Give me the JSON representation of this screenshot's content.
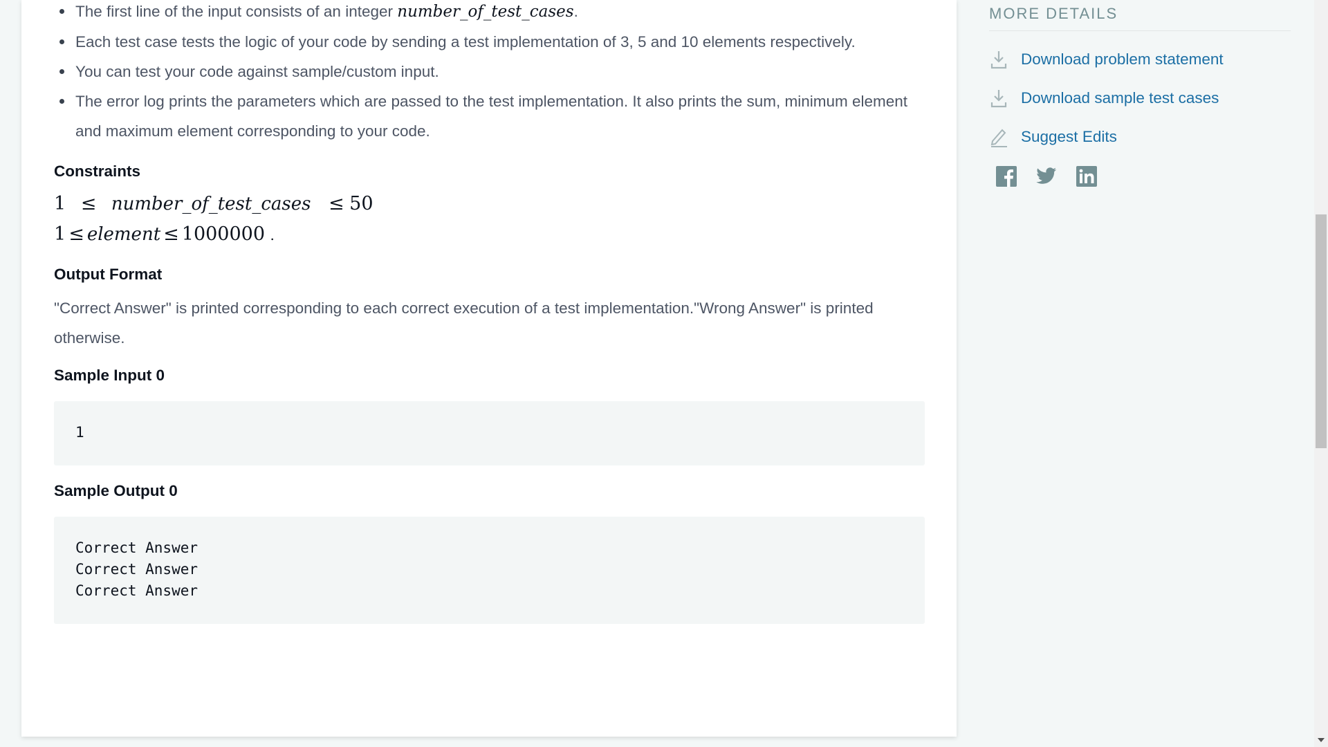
{
  "problem": {
    "bullets": [
      {
        "pre": "The first line of the input consists of an integer ",
        "math": "number_of_test_cases",
        "post": "."
      },
      {
        "text": "Each test case tests the logic of your code by sending a test implementation of 3, 5 and 10 elements respectively."
      },
      {
        "text": "You can test your code against sample/custom input."
      },
      {
        "text": "The error log prints the parameters which are passed to the test implementation. It also prints the sum, minimum element and maximum element corresponding to your code."
      }
    ],
    "constraints_heading": "Constraints",
    "constraint1": {
      "lo": "1",
      "op1": "≤",
      "var": "number_of_test_cases",
      "op2": "≤",
      "hi": "50"
    },
    "constraint2": {
      "lo": "1",
      "op1": "≤",
      "var": "element",
      "op2": "≤",
      "hi": "1000000",
      "post": "."
    },
    "output_heading": "Output Format",
    "output_text": "\"Correct Answer\" is printed corresponding to each correct execution of a test implementation.\"Wrong Answer\" is printed otherwise.",
    "sample_input_heading": "Sample Input 0",
    "sample_input": "1",
    "sample_output_heading": "Sample Output 0",
    "sample_output": "Correct Answer\nCorrect Answer\nCorrect Answer"
  },
  "sidebar": {
    "title": "MORE DETAILS",
    "links": [
      {
        "label": "Download problem statement",
        "icon": "download-icon"
      },
      {
        "label": "Download sample test cases",
        "icon": "download-icon"
      },
      {
        "label": "Suggest Edits",
        "icon": "pencil-icon"
      }
    ],
    "social": [
      "facebook-icon",
      "twitter-icon",
      "linkedin-icon"
    ]
  },
  "colors": {
    "link": "#1c6fa5",
    "icon_gray": "#738f93",
    "code_bg": "#f3f6f6",
    "page_bg": "#f3f7f7"
  }
}
